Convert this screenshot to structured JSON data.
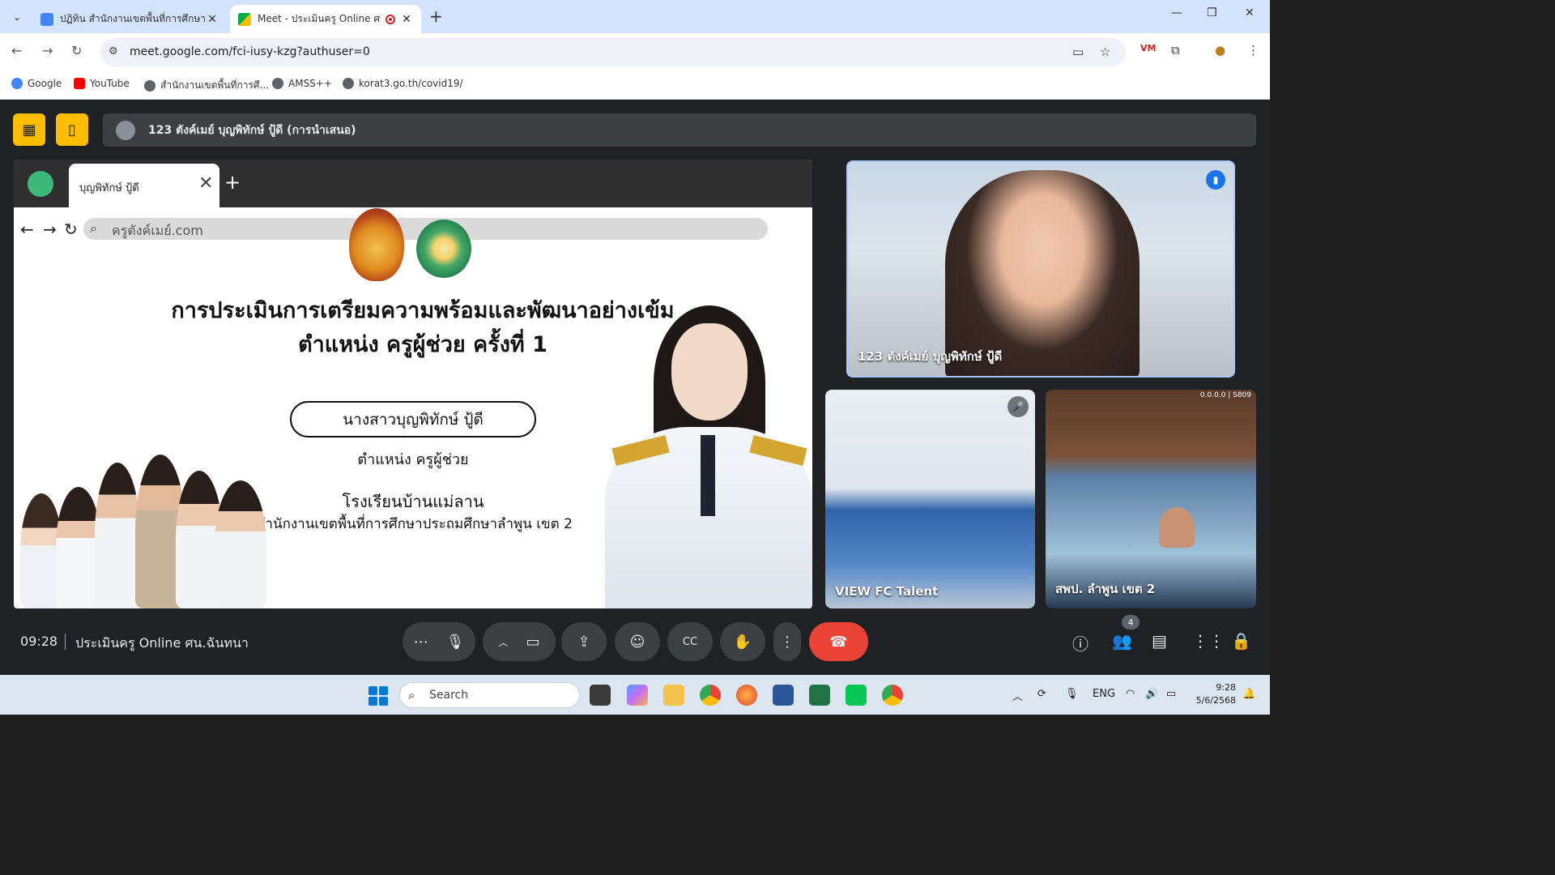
{
  "browser": {
    "tabs": [
      {
        "title": "ปฏิทิน สำนักงานเขตพื้นที่การศึกษาป"
      },
      {
        "title": "Meet - ประเมินครู Online ศน."
      }
    ],
    "new_tab": "+",
    "url": "meet.google.com/fci-iusy-kzg?authuser=0",
    "bookmarks": [
      {
        "label": "Google",
        "color": "#4285f4"
      },
      {
        "label": "YouTube",
        "color": "#ff0000"
      },
      {
        "label": "สำนักงานเขตพื้นที่การศึ...",
        "color": "#5f6368"
      },
      {
        "label": "AMSS++",
        "color": "#5f6368"
      },
      {
        "label": "korat3.go.th/covid19/",
        "color": "#5f6368"
      }
    ]
  },
  "meet": {
    "presenter_label": "123 ตังค์เมย์ บุญพิทักษ์ ปู้ดี (การนำเสนอ)",
    "time": "09:28",
    "meeting_name": "ประเมินครู Online ศน.ฉันทนา",
    "participant_count": "4",
    "tiles": [
      {
        "name": "123 ตังค์เมย์ บุญพิทักษ์ ปู้ดี"
      },
      {
        "name": "VIEW FC Talent"
      },
      {
        "name": "สพป. ลำพูน เขต 2",
        "hud": "0.0.0.0 | S809"
      }
    ],
    "controls": [
      "more-options",
      "microphone",
      "chevron-up",
      "camera",
      "present",
      "emoji",
      "captions",
      "raise-hand",
      "overflow",
      "leave-call"
    ],
    "accent_color": "#fbbc04",
    "leave_color": "#ea4335"
  },
  "slide": {
    "tab_title": "บุญพิทักษ์ ปู้ดี",
    "search_text": "ครูตังค์เมย์.com",
    "title_line1": "การประเมินการเตรียมความพร้อมและพัฒนาอย่างเข้ม",
    "title_line2": "ตำแหน่ง ครูผู้ช่วย ครั้งที่ 1",
    "person_name": "นางสาวบุญพิทักษ์ ปู้ดี",
    "position": "ตำแหน่ง ครูผู้ช่วย",
    "school": "โรงเรียนบ้านแม่ลาน",
    "office": "สำนักงานเขตพื้นที่การศึกษาประถมศึกษาลำพูน เขต 2"
  },
  "taskbar": {
    "search_label": "Search",
    "language": "ENG",
    "clock_time": "9:28",
    "clock_date": "5/6/2568"
  }
}
